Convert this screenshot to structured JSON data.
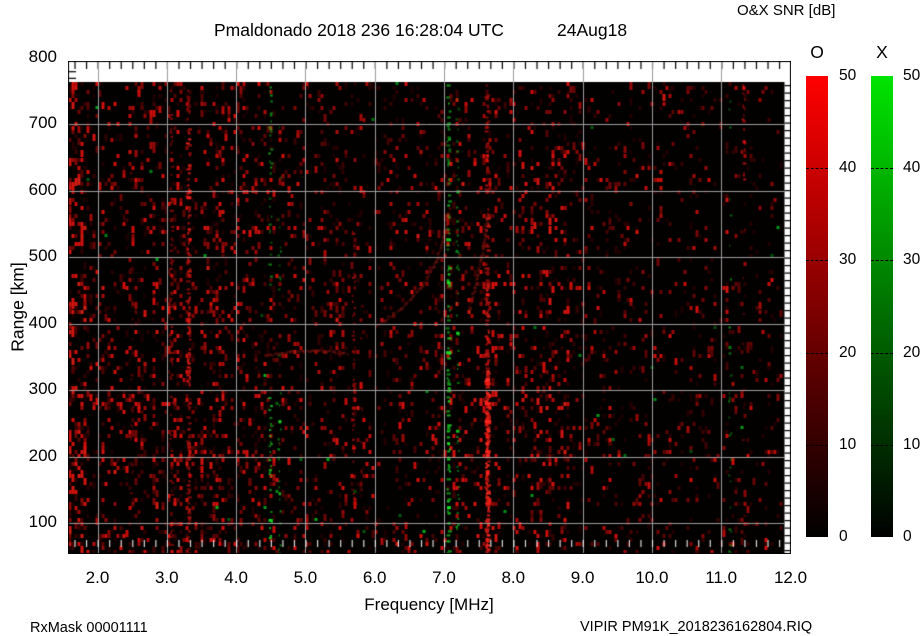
{
  "header": {
    "title": "Pmaldonado 2018 236 16:28:04 UTC",
    "date": "24Aug18",
    "colorbar_title": "O&X SNR [dB]"
  },
  "footer": {
    "rx_mask": "RxMask 00001111",
    "file_label": "VIPIR  PM91K_2018236162804.RIQ"
  },
  "chart_data": {
    "type": "heatmap",
    "title": "Pmaldonado 2018 236 16:28:04 UTC",
    "date_label": "24Aug18",
    "xlabel": "Frequency [MHz]",
    "ylabel": "Range [km]",
    "xlim": [
      1.57,
      12.0
    ],
    "ylim": [
      55,
      765
    ],
    "grid": true,
    "background": "#030000",
    "gridline_color": "#9c9c9c",
    "x_ticks": [
      {
        "v": 2,
        "t": "2.0"
      },
      {
        "v": 3,
        "t": "3.0"
      },
      {
        "v": 4,
        "t": "4.0"
      },
      {
        "v": 5,
        "t": "5.0"
      },
      {
        "v": 6,
        "t": "6.0"
      },
      {
        "v": 7,
        "t": "7.0"
      },
      {
        "v": 8,
        "t": "8.0"
      },
      {
        "v": 9,
        "t": "9.0"
      },
      {
        "v": 10,
        "t": "10.0"
      },
      {
        "v": 11,
        "t": "11.0"
      },
      {
        "v": 12,
        "t": "12.0"
      }
    ],
    "y_ticks": [
      {
        "v": 100,
        "t": "100"
      },
      {
        "v": 200,
        "t": "200"
      },
      {
        "v": 300,
        "t": "300"
      },
      {
        "v": 400,
        "t": "400"
      },
      {
        "v": 500,
        "t": "500"
      },
      {
        "v": 600,
        "t": "600"
      },
      {
        "v": 700,
        "t": "700"
      },
      {
        "v": 800,
        "t": "800"
      }
    ],
    "colorbar_title": "O&X SNR [dB]",
    "colorbars": [
      {
        "id": "o",
        "label": "O",
        "top_color": "#ff0000",
        "bottom_color": "#000000",
        "range": [
          0,
          50
        ],
        "ticks": [
          {
            "v": 0,
            "t": "0"
          },
          {
            "v": 10,
            "t": "10"
          },
          {
            "v": 20,
            "t": "20"
          },
          {
            "v": 30,
            "t": "30"
          },
          {
            "v": 40,
            "t": "40"
          },
          {
            "v": 50,
            "t": "50"
          }
        ]
      },
      {
        "id": "x",
        "label": "X",
        "top_color": "#00e400",
        "bottom_color": "#000000",
        "range": [
          0,
          50
        ],
        "ticks": [
          {
            "v": 0,
            "t": "0"
          },
          {
            "v": 10,
            "t": "10"
          },
          {
            "v": 20,
            "t": "20"
          },
          {
            "v": 30,
            "t": "30"
          },
          {
            "v": 40,
            "t": "40"
          },
          {
            "v": 50,
            "t": "50"
          }
        ]
      }
    ],
    "noise_bands": [
      {
        "f0": 1.55,
        "f1": 1.8,
        "density": 0.85,
        "bright": 0.6
      },
      {
        "f0": 1.8,
        "f1": 3.05,
        "density": 0.4,
        "bright": 0.4
      },
      {
        "f0": 3.05,
        "f1": 4.15,
        "density": 0.45,
        "bright": 0.42
      },
      {
        "f0": 4.15,
        "f1": 5.6,
        "density": 0.34,
        "bright": 0.36
      },
      {
        "f0": 5.6,
        "f1": 7.0,
        "density": 0.28,
        "bright": 0.34
      },
      {
        "f0": 7.0,
        "f1": 8.05,
        "density": 0.42,
        "bright": 0.46
      },
      {
        "f0": 8.05,
        "f1": 8.8,
        "density": 0.46,
        "bright": 0.46
      },
      {
        "f0": 8.8,
        "f1": 10.3,
        "density": 0.24,
        "bright": 0.32
      },
      {
        "f0": 10.3,
        "f1": 11.95,
        "density": 0.2,
        "bright": 0.3
      }
    ],
    "rfi_streaks": [
      {
        "freq": 2.5,
        "pol": "O",
        "w": 2.0,
        "segs": [
          {
            "k0": 100,
            "k1": 640,
            "d": 0.16,
            "i": 0.35
          }
        ]
      },
      {
        "freq": 3.07,
        "pol": "O",
        "w": 2.5,
        "segs": [
          {
            "k0": 55,
            "k1": 755,
            "d": 0.4,
            "i": 0.5
          }
        ]
      },
      {
        "freq": 3.32,
        "pol": "O",
        "w": 3.0,
        "segs": [
          {
            "k0": 55,
            "k1": 300,
            "d": 0.5,
            "i": 0.65
          },
          {
            "k0": 300,
            "k1": 700,
            "d": 0.55,
            "i": 0.8
          },
          {
            "k0": 700,
            "k1": 755,
            "d": 0.35,
            "i": 0.5
          }
        ]
      },
      {
        "freq": 4.5,
        "pol": "X",
        "w": 2.5,
        "segs": [
          {
            "k0": 55,
            "k1": 290,
            "d": 0.38,
            "i": 0.75
          },
          {
            "k0": 290,
            "k1": 620,
            "d": 0.14,
            "i": 0.5
          },
          {
            "k0": 620,
            "k1": 760,
            "d": 0.28,
            "i": 0.6
          }
        ]
      },
      {
        "freq": 4.63,
        "pol": "X",
        "w": 2.0,
        "segs": [
          {
            "k0": 55,
            "k1": 300,
            "d": 0.25,
            "i": 0.6
          },
          {
            "k0": 300,
            "k1": 760,
            "d": 0.1,
            "i": 0.45
          }
        ]
      },
      {
        "freq": 5.7,
        "pol": "O",
        "w": 2.5,
        "segs": [
          {
            "k0": 120,
            "k1": 540,
            "d": 0.33,
            "i": 0.55
          }
        ]
      },
      {
        "freq": 5.82,
        "pol": "O",
        "w": 2.0,
        "segs": [
          {
            "k0": 150,
            "k1": 500,
            "d": 0.15,
            "i": 0.4
          }
        ]
      },
      {
        "freq": 7.07,
        "pol": "X",
        "w": 3.0,
        "segs": [
          {
            "k0": 55,
            "k1": 300,
            "d": 0.55,
            "i": 0.9
          },
          {
            "k0": 300,
            "k1": 500,
            "d": 0.42,
            "i": 0.85
          },
          {
            "k0": 500,
            "k1": 760,
            "d": 0.32,
            "i": 0.7
          }
        ]
      },
      {
        "freq": 7.2,
        "pol": "X",
        "w": 2.0,
        "segs": [
          {
            "k0": 55,
            "k1": 400,
            "d": 0.22,
            "i": 0.6
          },
          {
            "k0": 400,
            "k1": 760,
            "d": 0.13,
            "i": 0.5
          }
        ]
      },
      {
        "freq": 7.63,
        "pol": "O",
        "w": 3.5,
        "segs": [
          {
            "k0": 55,
            "k1": 330,
            "d": 0.92,
            "i": 1.0
          },
          {
            "k0": 330,
            "k1": 560,
            "d": 0.55,
            "i": 0.8
          },
          {
            "k0": 560,
            "k1": 760,
            "d": 0.45,
            "i": 0.62
          }
        ]
      },
      {
        "freq": 11.13,
        "pol": "X",
        "w": 2.0,
        "segs": [
          {
            "k0": 55,
            "k1": 760,
            "d": 0.11,
            "i": 0.5
          }
        ]
      },
      {
        "freq": 11.33,
        "pol": "O",
        "w": 2.5,
        "segs": [
          {
            "k0": 600,
            "k1": 760,
            "d": 0.35,
            "i": 0.6
          },
          {
            "k0": 100,
            "k1": 600,
            "d": 0.07,
            "i": 0.3
          }
        ]
      }
    ],
    "echo_traces": [
      {
        "color": "#8c1810",
        "w": 3,
        "a": 0.55,
        "pts": [
          [
            4.42,
            352
          ],
          [
            4.8,
            358
          ],
          [
            5.2,
            360
          ],
          [
            5.62,
            355
          ]
        ]
      },
      {
        "color": "#901a12",
        "w": 3,
        "a": 0.5,
        "pts": [
          [
            6.02,
            396
          ],
          [
            6.4,
            424
          ],
          [
            6.7,
            458
          ],
          [
            6.9,
            495
          ],
          [
            7.02,
            540
          ],
          [
            7.08,
            575
          ]
        ]
      },
      {
        "color": "#a01c14",
        "w": 3,
        "a": 0.45,
        "pts": [
          [
            7.36,
            420
          ],
          [
            7.47,
            462
          ],
          [
            7.57,
            515
          ],
          [
            7.63,
            565
          ]
        ]
      }
    ]
  }
}
